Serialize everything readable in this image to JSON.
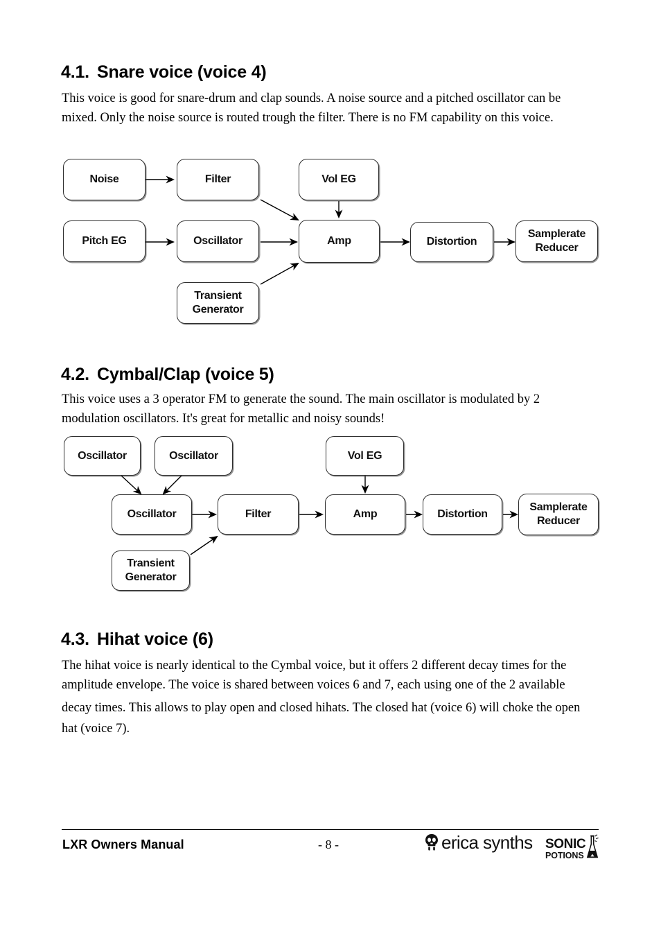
{
  "document": {
    "title": "LXR Owners Manual",
    "page_number": "- 8 -"
  },
  "sections": [
    {
      "number": "4.1.",
      "title": "Snare voice (voice 4)",
      "paragraph": "This voice is good for snare-drum and clap sounds. A noise source and a pitched oscillator can be mixed. Only the noise source is routed trough the filter. There is no FM capability on this voice."
    },
    {
      "number": "4.2.",
      "title": "Cymbal/Clap (voice 5)",
      "paragraph": "This voice uses a 3 operator FM to generate the sound. The main oscillator is modulated by 2 modulation oscillators. It's great for metallic and noisy sounds!"
    },
    {
      "number": "4.3.",
      "title": "Hihat voice (6)",
      "paragraph_line_1": "The hihat voice is nearly identical to the Cymbal voice, but it offers 2 different decay times for the amplitude envelope. The voice is shared between voices 6 and 7, each using one of the 2 available",
      "paragraph_line_2": "decay times. This allows to  play open and closed hihats. The closed hat (voice 6) will choke the open hat (voice 7)."
    }
  ],
  "diagram_snare": {
    "name": "Snare voice signal flow",
    "nodes": {
      "noise": "Noise",
      "filter": "Filter",
      "vol_eg": "Vol EG",
      "pitch_eg": "Pitch EG",
      "oscillator": "Oscillator",
      "amp": "Amp",
      "distortion": "Distortion",
      "samplerate_reducer_line1": "Samplerate",
      "samplerate_reducer_line2": "Reducer",
      "transient_line1": "Transient",
      "transient_line2": "Generator"
    },
    "edges": [
      "Noise -> Filter",
      "Filter -> Amp",
      "Vol EG -> Amp",
      "Pitch EG -> Oscillator",
      "Oscillator -> Amp",
      "Transient Generator -> Amp",
      "Amp -> Distortion",
      "Distortion -> Samplerate Reducer"
    ]
  },
  "diagram_cymbal": {
    "name": "Cymbal/Clap voice signal flow",
    "nodes": {
      "mod_osc_1": "Oscillator",
      "mod_osc_2": "Oscillator",
      "main_osc": "Oscillator",
      "filter": "Filter",
      "vol_eg": "Vol EG",
      "amp": "Amp",
      "distortion": "Distortion",
      "samplerate_reducer_line1": "Samplerate",
      "samplerate_reducer_line2": "Reducer",
      "transient_line1": "Transient",
      "transient_line2": "Generator"
    },
    "edges": [
      "Oscillator (mod 1) -> Oscillator (main)",
      "Oscillator (mod 2) -> Oscillator (main)",
      "Oscillator (main) -> Filter",
      "Transient Generator -> Filter",
      "Filter -> Amp",
      "Vol EG -> Amp",
      "Amp -> Distortion",
      "Distortion -> Samplerate Reducer"
    ]
  },
  "logos": {
    "erica_synths": "erica synths",
    "sonic_top": "SONIC",
    "sonic_bottom": "POTIONS"
  },
  "colors": {
    "text": "#000000",
    "box_border": "#2e2e2e",
    "page_background": "#ffffff"
  }
}
